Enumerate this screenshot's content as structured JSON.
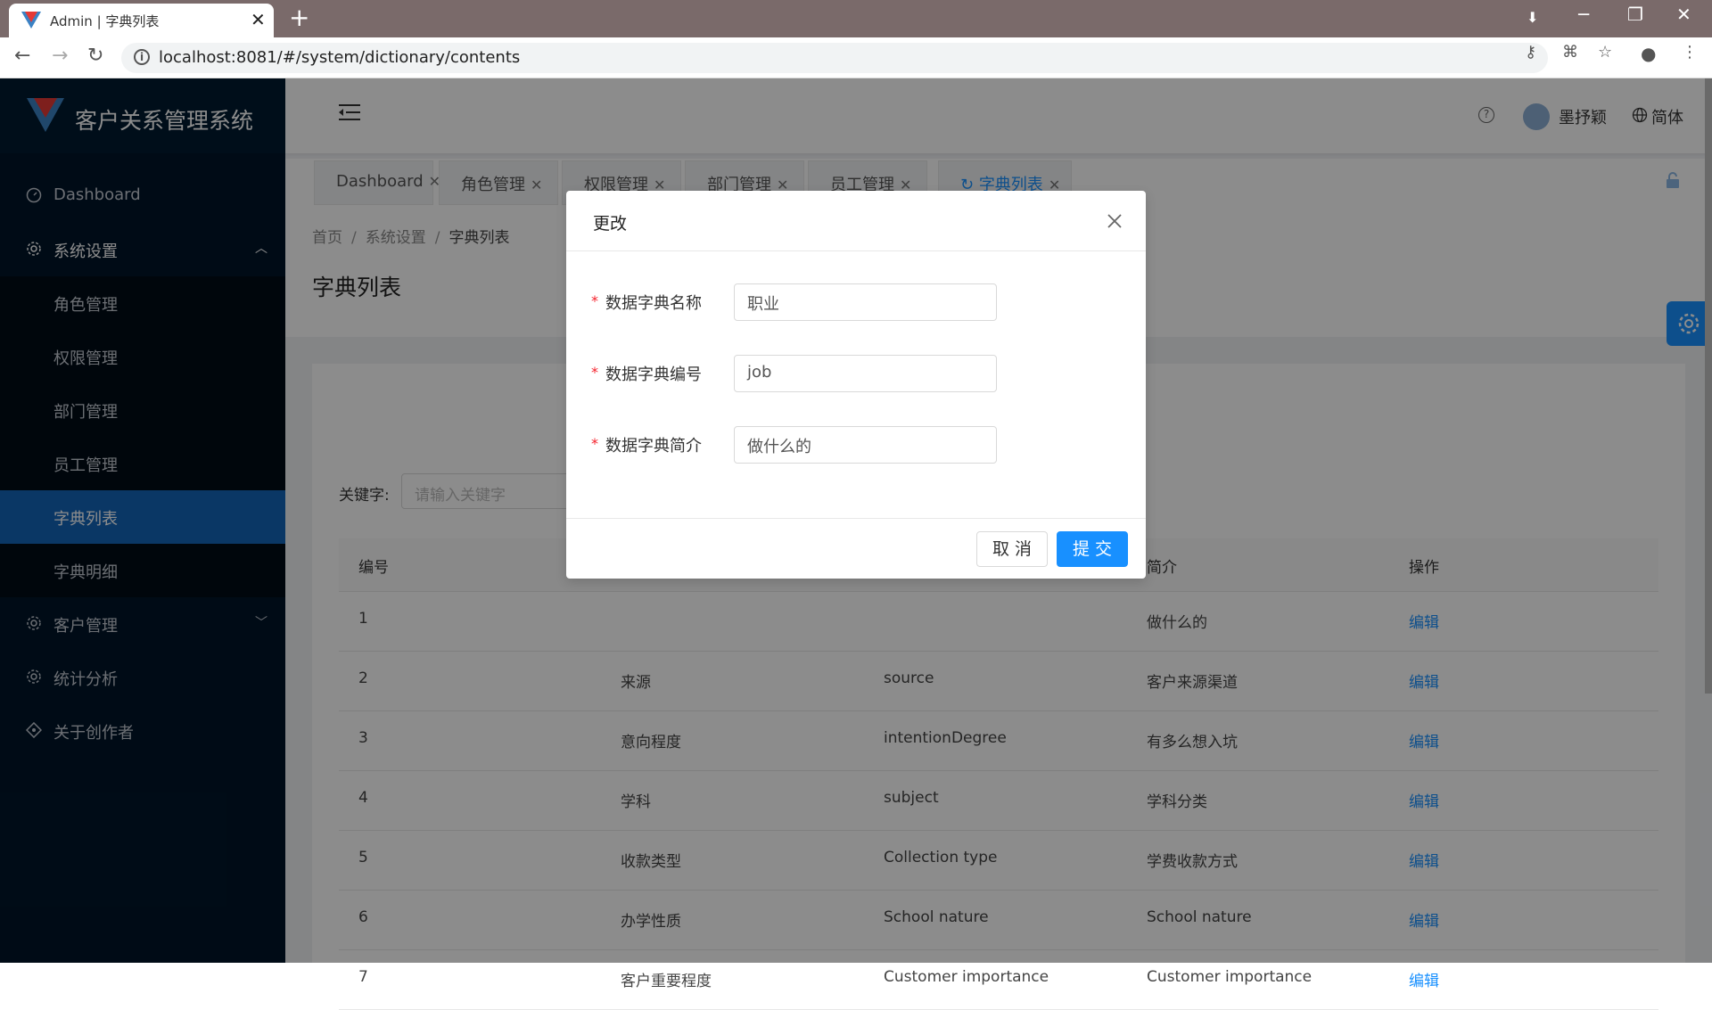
{
  "browser": {
    "tab_title": "Admin | 字典列表",
    "url": "localhost:8081/#/system/dictionary/contents"
  },
  "sidebar": {
    "brand": "客户关系管理系统",
    "items": [
      {
        "label": "Dashboard",
        "icon": "dashboard-icon"
      },
      {
        "label": "系统设置",
        "icon": "gear-icon",
        "expanded": true
      },
      {
        "label": "客户管理",
        "icon": "gear-icon"
      },
      {
        "label": "统计分析",
        "icon": "gear-icon"
      },
      {
        "label": "关于创作者",
        "icon": "diamond-icon"
      }
    ],
    "submenu": [
      {
        "label": "角色管理"
      },
      {
        "label": "权限管理"
      },
      {
        "label": "部门管理"
      },
      {
        "label": "员工管理"
      },
      {
        "label": "字典列表",
        "active": true
      },
      {
        "label": "字典明细"
      }
    ]
  },
  "header": {
    "user": "墨抒颖",
    "language": "简体"
  },
  "tags": [
    {
      "label": "Dashboard"
    },
    {
      "label": "角色管理"
    },
    {
      "label": "权限管理"
    },
    {
      "label": "部门管理"
    },
    {
      "label": "员工管理"
    },
    {
      "label": "字典列表",
      "active": true
    }
  ],
  "breadcrumb": [
    "首页",
    "系统设置",
    "字典列表"
  ],
  "page_title": "字典列表",
  "search": {
    "label": "关键字:",
    "placeholder": "请输入关键字"
  },
  "table": {
    "headers": [
      "编号",
      "",
      "",
      "简介",
      "操作"
    ],
    "rows": [
      {
        "id": "1",
        "name": "",
        "code": "",
        "desc": "做什么的",
        "action": "编辑"
      },
      {
        "id": "2",
        "name": "来源",
        "code": "source",
        "desc": "客户来源渠道",
        "action": "编辑"
      },
      {
        "id": "3",
        "name": "意向程度",
        "code": "intentionDegree",
        "desc": "有多么想入坑",
        "action": "编辑"
      },
      {
        "id": "4",
        "name": "学科",
        "code": "subject",
        "desc": "学科分类",
        "action": "编辑"
      },
      {
        "id": "5",
        "name": "收款类型",
        "code": "Collection type",
        "desc": "学费收款方式",
        "action": "编辑"
      },
      {
        "id": "6",
        "name": "办学性质",
        "code": "School nature",
        "desc": "School nature",
        "action": "编辑"
      },
      {
        "id": "7",
        "name": "客户重要程度",
        "code": "Customer importance",
        "desc": "Customer importance",
        "action": "编辑"
      }
    ]
  },
  "modal": {
    "title": "更改",
    "fields": [
      {
        "label": "数据字典名称",
        "value": "职业"
      },
      {
        "label": "数据字典编号",
        "value": "job"
      },
      {
        "label": "数据字典简介",
        "value": "做什么的"
      }
    ],
    "cancel_label": "取 消",
    "submit_label": "提 交"
  },
  "colors": {
    "sidebar_bg": "#001529",
    "active_menu": "#1364b9",
    "primary": "#1890ff",
    "required": "#f5222d"
  }
}
